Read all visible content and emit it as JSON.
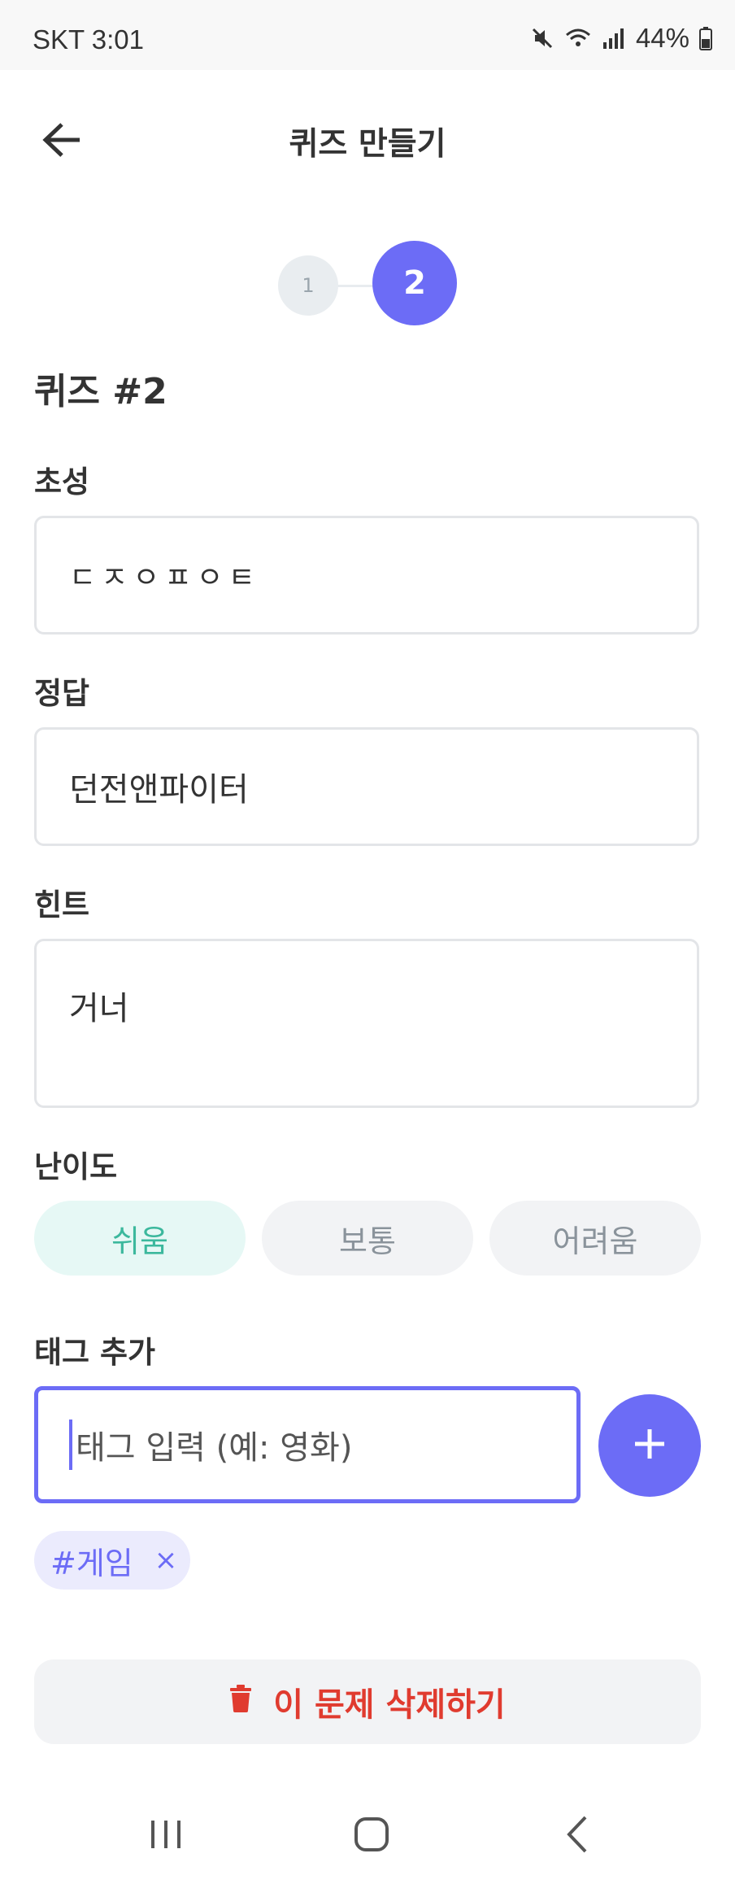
{
  "status_bar": {
    "carrier_time": "SKT 3:01",
    "battery": "44%",
    "icons": [
      "mute-icon",
      "wifi-icon",
      "signal-icon",
      "battery-icon"
    ]
  },
  "header": {
    "title": "퀴즈 만들기",
    "back_icon": "arrow-left-icon"
  },
  "stepper": {
    "steps": [
      "1",
      "2"
    ],
    "active_step": 2
  },
  "quiz": {
    "title": "퀴즈 #2",
    "consonants_label": "초성",
    "consonants_value": "ㄷㅈㅇㅍㅇㅌ",
    "answer_label": "정답",
    "answer_value": "던전앤파이터",
    "hint_label": "힌트",
    "hint_value": "거너"
  },
  "difficulty": {
    "label": "난이도",
    "options": [
      "쉬움",
      "보통",
      "어려움"
    ],
    "selected": "쉬움"
  },
  "tags": {
    "label": "태그 추가",
    "placeholder": "태그 입력 (예: 영화)",
    "add_icon": "plus-icon",
    "items": [
      {
        "text": "#게임",
        "remove": "×"
      }
    ]
  },
  "actions": {
    "delete_label": "이 문제 삭제하기",
    "delete_icon": "trash-icon"
  },
  "colors": {
    "accent": "#6c6cf6",
    "easy": "#3cb89d",
    "danger": "#e03b2f"
  },
  "nav": {
    "icons": [
      "recent-apps-icon",
      "home-icon",
      "back-icon"
    ]
  }
}
